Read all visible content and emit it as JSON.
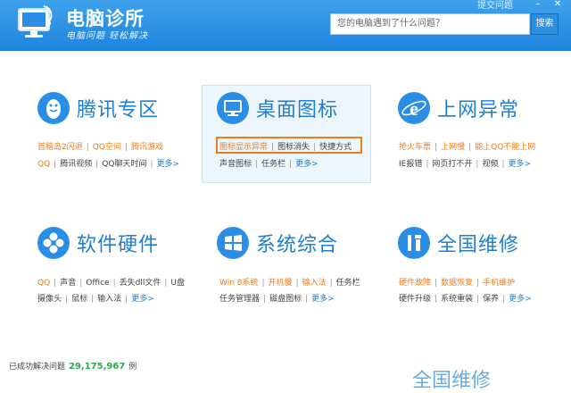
{
  "header": {
    "title": "电脑诊所",
    "subtitle": "电脑问题  轻松解决",
    "top_link": "提交问题",
    "min_symbol": "–",
    "close_symbol": "✕",
    "search_placeholder": "您的电脑遇到了什么问题？",
    "search_button": "搜索"
  },
  "categories": [
    {
      "title": "腾讯专区",
      "icon": "penguin-icon",
      "row1": [
        "首脑岛2闪退",
        "QQ空间",
        "腾讯游戏"
      ],
      "row2": [
        "QQ",
        "腾讯视频",
        "QQ聊天时间"
      ],
      "more": "更多>"
    },
    {
      "title": "桌面图标",
      "icon": "monitor-icon",
      "row1": [
        "图标显示异常",
        "图标消失",
        "快捷方式"
      ],
      "row2": [
        "声音图标",
        "任务栏"
      ],
      "more": "更多>"
    },
    {
      "title": "上网异常",
      "icon": "ie-icon",
      "row1": [
        "抢火车票",
        "上网慢",
        "能上QQ不能上网"
      ],
      "row2": [
        "IE报错",
        "网页打不开",
        "视频"
      ],
      "more": "更多>"
    },
    {
      "title": "软件硬件",
      "icon": "software-hardware-icon",
      "row1": [
        "QQ",
        "声音",
        "Office",
        "丢失dll文件",
        "U盘"
      ],
      "row2": [
        "摄像头",
        "鼠标",
        "输入法"
      ],
      "more": "更多>"
    },
    {
      "title": "系统综合",
      "icon": "windows-icon",
      "row1": [
        "Win 8系统",
        "开机慢",
        "输入法",
        "任务栏"
      ],
      "row2": [
        "任务管理器",
        "磁盘图标"
      ],
      "more": "更多>"
    },
    {
      "title": "全国维修",
      "icon": "repair-tools-icon",
      "row1": [
        "硬件故障",
        "数据恢复",
        "手机维护"
      ],
      "row2": [
        "硬件升级",
        "系统重装",
        "保养"
      ],
      "more": "更多>"
    }
  ],
  "status": {
    "prefix": "已成功解决问题",
    "count": "29,175,967",
    "suffix": "例"
  },
  "ghost_text": "全国维修",
  "colors": {
    "header": "#1f84dc",
    "accent": "#1e7fd6",
    "orange": "#f07c1a",
    "count": "#33a54a"
  }
}
